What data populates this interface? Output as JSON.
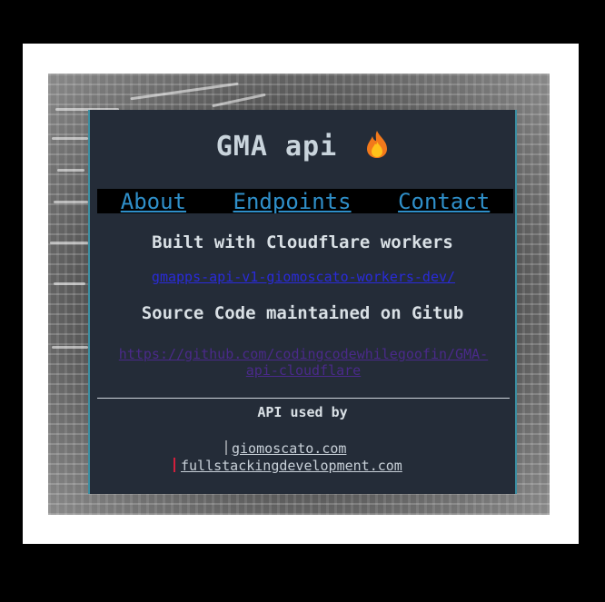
{
  "app": {
    "title": "GMA api",
    "title_icon": "fire-icon"
  },
  "nav": {
    "items": [
      "About",
      "Endpoints",
      "Contact"
    ]
  },
  "content": {
    "built_with": "Built with Cloudflare workers",
    "worker_link": "gmapps-api-v1-giomoscato-workers-dev/",
    "source_text": "Source Code maintained on Gitub",
    "github_link_line1": "https://github.com/codingcodewhilegoofin/GMA-",
    "github_link_line2": "api-cloudflare"
  },
  "footer": {
    "heading": "API used by",
    "sites": [
      "giomoscato.com",
      "fullstackingdevelopment.com"
    ]
  },
  "colors": {
    "card_bg": "#242c38",
    "nav_link": "#2f8fc9",
    "worker_link": "#2a2bd9",
    "github_link": "#4a2a8a",
    "accent_bar_1": "#8a8f96",
    "accent_bar_2": "#d21f3c"
  }
}
